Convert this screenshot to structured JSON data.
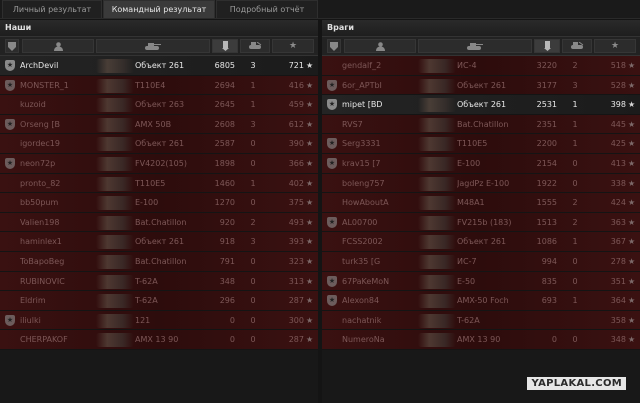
{
  "tabs": [
    {
      "label": "Личный результат"
    },
    {
      "label": "Командный результат"
    },
    {
      "label": "Подробный отчёт"
    }
  ],
  "allies": {
    "title": "Наши",
    "rows": [
      {
        "medal": true,
        "player": "ArchDevil",
        "tank": "Объект 261",
        "damage": "6805",
        "kills": "3",
        "xp": "721",
        "alive": true
      },
      {
        "medal": true,
        "player": "MONSTER_1",
        "tank": "T110E4",
        "damage": "2694",
        "kills": "1",
        "xp": "416",
        "alive": false
      },
      {
        "medal": false,
        "player": "kuzoid",
        "tank": "Объект 263",
        "damage": "2645",
        "kills": "1",
        "xp": "459",
        "alive": false
      },
      {
        "medal": true,
        "player": "Orseng [B",
        "tank": "AMX 50B",
        "damage": "2608",
        "kills": "3",
        "xp": "612",
        "alive": false
      },
      {
        "medal": false,
        "player": "igordec19",
        "tank": "Объект 261",
        "damage": "2587",
        "kills": "0",
        "xp": "390",
        "alive": false
      },
      {
        "medal": true,
        "player": "neon72p",
        "tank": "FV4202(105)",
        "damage": "1898",
        "kills": "0",
        "xp": "366",
        "alive": false
      },
      {
        "medal": false,
        "player": "pronto_82",
        "tank": "T110E5",
        "damage": "1460",
        "kills": "1",
        "xp": "402",
        "alive": false
      },
      {
        "medal": false,
        "player": "bb50pum",
        "tank": "E-100",
        "damage": "1270",
        "kills": "0",
        "xp": "375",
        "alive": false
      },
      {
        "medal": false,
        "player": "Valien198",
        "tank": "Bat.Chatillon",
        "damage": "920",
        "kills": "2",
        "xp": "493",
        "alive": false
      },
      {
        "medal": false,
        "player": "haminlex1",
        "tank": "Объект 261",
        "damage": "918",
        "kills": "3",
        "xp": "393",
        "alive": false
      },
      {
        "medal": false,
        "player": "ToBapoBeg",
        "tank": "Bat.Chatillon",
        "damage": "791",
        "kills": "0",
        "xp": "323",
        "alive": false
      },
      {
        "medal": false,
        "player": "RUBINOVIC",
        "tank": "T-62A",
        "damage": "348",
        "kills": "0",
        "xp": "313",
        "alive": false
      },
      {
        "medal": false,
        "player": "Eldrim",
        "tank": "T-62A",
        "damage": "296",
        "kills": "0",
        "xp": "287",
        "alive": false
      },
      {
        "medal": true,
        "player": "iliulki",
        "tank": "121",
        "damage": "0",
        "kills": "0",
        "xp": "300",
        "alive": false
      },
      {
        "medal": false,
        "player": "CHERPAKOF",
        "tank": "AMX 13 90",
        "damage": "0",
        "kills": "0",
        "xp": "287",
        "alive": false
      }
    ]
  },
  "enemies": {
    "title": "Враги",
    "rows": [
      {
        "medal": false,
        "player": "gendalf_2",
        "tank": "ИС-4",
        "damage": "3220",
        "kills": "2",
        "xp": "518",
        "alive": false
      },
      {
        "medal": true,
        "player": "6or_APTbI",
        "tank": "Объект 261",
        "damage": "3177",
        "kills": "3",
        "xp": "528",
        "alive": false
      },
      {
        "medal": true,
        "player": "mipet [BD",
        "tank": "Объект 261",
        "damage": "2531",
        "kills": "1",
        "xp": "398",
        "alive": true
      },
      {
        "medal": false,
        "player": "RVS7",
        "tank": "Bat.Chatillon",
        "damage": "2351",
        "kills": "1",
        "xp": "445",
        "alive": false
      },
      {
        "medal": true,
        "player": "Serg3331",
        "tank": "T110E5",
        "damage": "2200",
        "kills": "1",
        "xp": "425",
        "alive": false
      },
      {
        "medal": true,
        "player": "krav15 [7",
        "tank": "E-100",
        "damage": "2154",
        "kills": "0",
        "xp": "413",
        "alive": false
      },
      {
        "medal": false,
        "player": "boleng757",
        "tank": "JagdPz E-100",
        "damage": "1922",
        "kills": "0",
        "xp": "338",
        "alive": false
      },
      {
        "medal": false,
        "player": "HowAboutA",
        "tank": "M48A1",
        "damage": "1555",
        "kills": "2",
        "xp": "424",
        "alive": false
      },
      {
        "medal": true,
        "player": "AL00700",
        "tank": "FV215b (183)",
        "damage": "1513",
        "kills": "2",
        "xp": "363",
        "alive": false
      },
      {
        "medal": false,
        "player": "FCSS2002",
        "tank": "Объект 261",
        "damage": "1086",
        "kills": "1",
        "xp": "367",
        "alive": false
      },
      {
        "medal": false,
        "player": "turk35 [G",
        "tank": "ИС-7",
        "damage": "994",
        "kills": "0",
        "xp": "278",
        "alive": false
      },
      {
        "medal": true,
        "player": "67PaKeMoN",
        "tank": "E-50",
        "damage": "835",
        "kills": "0",
        "xp": "351",
        "alive": false
      },
      {
        "medal": true,
        "player": "Alexon84",
        "tank": "AMX-50 Foch",
        "damage": "693",
        "kills": "1",
        "xp": "364",
        "alive": false
      },
      {
        "medal": false,
        "player": "nachatnik",
        "tank": "T-62A",
        "damage": "",
        "kills": "",
        "xp": "358",
        "alive": false
      },
      {
        "medal": false,
        "player": "NumeroNa",
        "tank": "AMX 13 90",
        "damage": "0",
        "kills": "0",
        "xp": "348",
        "alive": false
      }
    ]
  },
  "watermark": "YAPLAKAL.COM",
  "icons": {
    "medal": "medal-icon",
    "player": "player-icon",
    "tank": "tank-icon",
    "damage": "damage-icon",
    "kills": "kills-icon",
    "xp": "star-icon"
  }
}
